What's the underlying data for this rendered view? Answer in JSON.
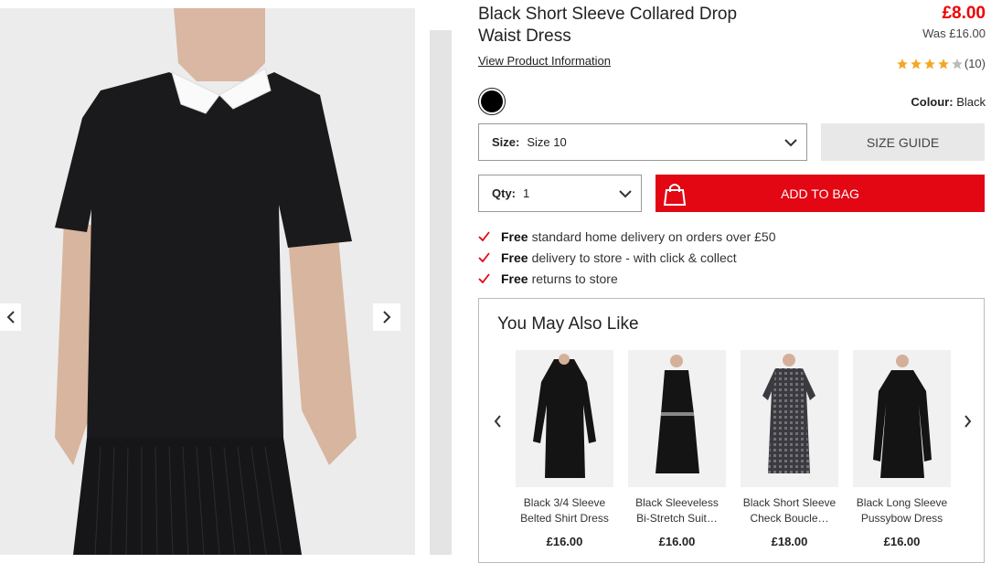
{
  "product": {
    "title": "Black Short Sleeve Collared Drop Waist Dress",
    "price": "£8.00",
    "was_price": "Was £16.00",
    "view_info": "View Product Information",
    "rating": {
      "stars": 4,
      "max": 5,
      "count": "(10)"
    },
    "colour_label": "Colour:",
    "colour_value": "Black",
    "swatch_color": "#000000"
  },
  "size": {
    "label": "Size:",
    "value": "Size 10"
  },
  "size_guide": "SIZE GUIDE",
  "qty": {
    "label": "Qty:",
    "value": "1"
  },
  "add_to_bag": "ADD TO BAG",
  "perks": [
    {
      "bold": "Free",
      "text": "standard home delivery on orders over £50"
    },
    {
      "bold": "Free",
      "text": "delivery to store - with click & collect"
    },
    {
      "bold": "Free",
      "text": "returns to store"
    }
  ],
  "you_may_also_like": {
    "title": "You May Also Like",
    "items": [
      {
        "name": "Black 3/4 Sleeve Belted Shirt Dress",
        "price": "£16.00"
      },
      {
        "name": "Black Sleeveless Bi-Stretch Suit…",
        "price": "£16.00"
      },
      {
        "name": "Black Short Sleeve Check Boucle…",
        "price": "£18.00"
      },
      {
        "name": "Black Long Sleeve Pussybow Dress",
        "price": "£16.00"
      }
    ]
  },
  "colors": {
    "accent_red": "#e30613",
    "price_red": "#ee0000",
    "star": "#f5a623"
  },
  "icons": [
    "chevron-left-icon",
    "chevron-right-icon",
    "chevron-down-icon",
    "star-icon",
    "shopping-bag-icon",
    "checkmark-icon"
  ]
}
